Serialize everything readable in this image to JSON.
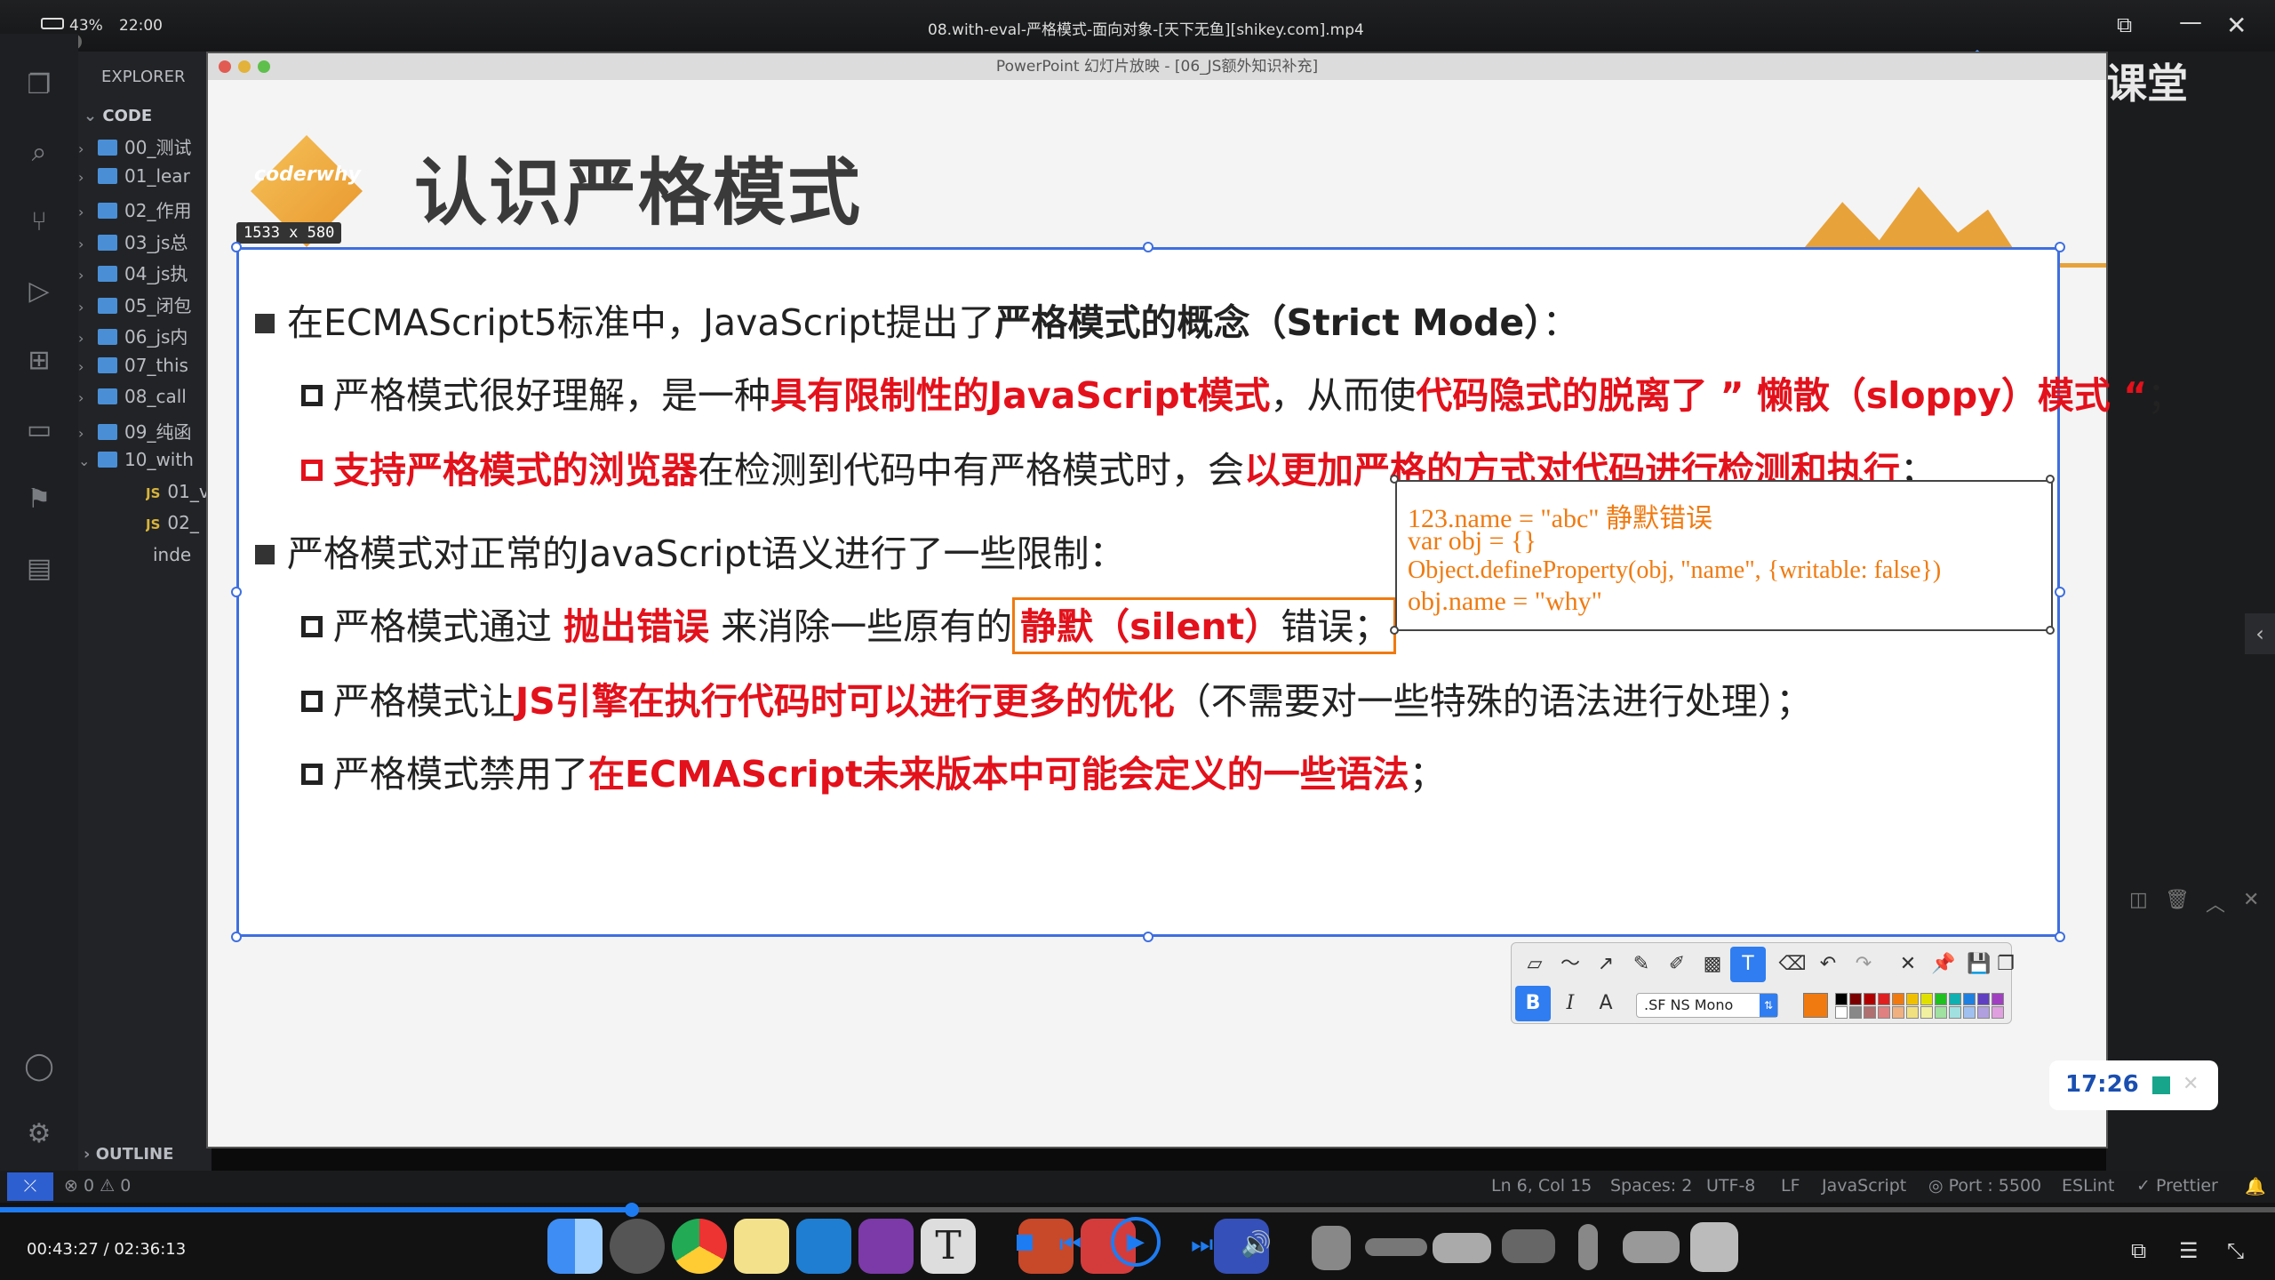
{
  "topbar": {
    "battery": "43%",
    "clock": "22:00",
    "video_title": "08.with-eval-严格模式-面向对象-[天下无鱼][shikey.com].mp4"
  },
  "sidebar": {
    "explorer_label": "EXPLORER",
    "code_label": "CODE",
    "folders": [
      "00_测试",
      "01_lear",
      "02_作用",
      "03_js总",
      "04_js执",
      "05_闭包",
      "06_js内",
      "07_this",
      "08_call",
      "09_纯函",
      "10_with"
    ],
    "files": [
      "01_v",
      "02_",
      "inde"
    ],
    "outline_label": "OUTLINE",
    "errors": "0",
    "warnings": "0"
  },
  "ppt": {
    "window_title": "PowerPoint 幻灯片放映 - [06_JS额外知识补充]",
    "logo_text": "coderwhy",
    "slide_title": "认识严格模式",
    "size_badge": "1533 x 580",
    "line1_a": "在ECMAScript5标准中，JavaScript提出了",
    "line1_b": "严格模式的概念（Strict Mode）",
    "line1_c": "：",
    "line2_a": "严格模式很好理解，是一种",
    "line2_b": "具有限制性的JavaScript模式",
    "line2_c": "，从而使",
    "line2_d": "代码隐式的脱离了 ” 懒散（sloppy）模式 “",
    "line2_e": "；",
    "line3_a": "支持严格模式的浏览器",
    "line3_b": "在检测到代码中有严格模式时，会",
    "line3_c": "以更加严格的方式对代码进行检测和执行",
    "line3_d": "；",
    "line4": "严格模式对正常的JavaScript语义进行了一些限制：",
    "line5_a": "严格模式通过 ",
    "line5_b": "抛出错误",
    "line5_c": " 来消除一些原有的",
    "line5_d": "静默（silent）",
    "line5_e": "错误；",
    "line6_a": "严格模式让",
    "line6_b": "JS引擎在执行代码时可以进行更多的优化",
    "line6_c": "（不需要对一些特殊的语法进行处理）；",
    "line7_a": "严格模式禁用了",
    "line7_b": "在ECMAScript未来版本中可能会定义的一些语法",
    "line7_c": "；",
    "code1": "123.name = \"abc\" 静默错误",
    "code2": "var obj = {}",
    "code3": "Object.defineProperty(obj, \"name\", {writable: false})",
    "code4": "obj.name = \"why\""
  },
  "toolbar": {
    "font_name": ".SF NS Mono",
    "bold": "B",
    "italic": "I",
    "shadow": "A",
    "text_tool": "T",
    "swatches": [
      "#000000",
      "#7a0000",
      "#b00000",
      "#e02020",
      "#f07a10",
      "#f0c000",
      "#e0e000",
      "#20c020",
      "#10b0b0",
      "#2080e0",
      "#6040c0",
      "#a040c0",
      "#ffffff",
      "#888888",
      "#b07070",
      "#e08080",
      "#f0b080",
      "#f0e080",
      "#f0f0a0",
      "#a0e0a0",
      "#a0e0e0",
      "#a0c0f0",
      "#b0a0e0",
      "#e0a0e0"
    ],
    "current_color": "#f07a10"
  },
  "statusbar": {
    "position": "Ln 6, Col 15",
    "spaces": "Spaces: 2",
    "encoding": "UTF-8",
    "eol": "LF",
    "language": "JavaScript",
    "port": "Port : 5500",
    "eslint": "ESLint",
    "prettier": "Prettier"
  },
  "player": {
    "time": "00:43:27 / 02:36:13",
    "progress": 0.2778,
    "timer_chip": "17:26",
    "brand": "腾讯课堂"
  }
}
